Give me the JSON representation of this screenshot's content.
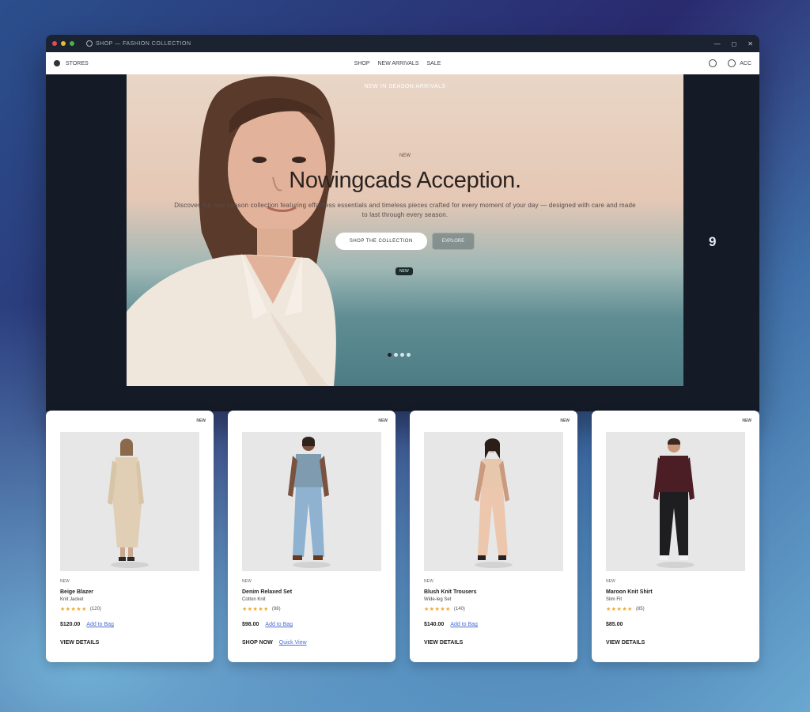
{
  "window": {
    "title": "SHOP — FASHION COLLECTION",
    "controls": [
      "—",
      "◻",
      "✕"
    ]
  },
  "navbar": {
    "brand": "STORES",
    "links": [
      "SHOP",
      "NEW ARRIVALS",
      "SALE"
    ],
    "user_label": "ACC"
  },
  "hero": {
    "top_label": "NEW IN SEASON ARRIVALS",
    "kicker": "NEW",
    "title": "Nowingcads Acception.",
    "subtitle": "Discover the new season collection featuring effortless essentials and timeless pieces crafted for every moment of your day — designed with care and made to last through every season.",
    "primary_button": "SHOP THE COLLECTION",
    "secondary_button": "EXPLORE",
    "tag": "NEW",
    "next_arrow": "9",
    "slide_count": 4,
    "active_slide": 0
  },
  "colors": {
    "accent_link": "#4a6fd4",
    "star": "#f1a62c",
    "card_bg": "#ffffff"
  },
  "products": [
    {
      "badge": "NEW",
      "category": "NEW",
      "name": "Beige Blazer",
      "desc": "Knit Jacket",
      "stars": "★★★★★",
      "reviews": "(120)",
      "price": "$120.00",
      "price_link": "Add to Bag",
      "cta": "VIEW DETAILS",
      "cta_link": ""
    },
    {
      "badge": "NEW",
      "category": "NEW",
      "name": "Denim Relaxed Set",
      "desc": "Cotton Knit",
      "stars": "★★★★★",
      "reviews": "(98)",
      "price": "$98.00",
      "price_link": "Add to Bag",
      "cta": "SHOP NOW",
      "cta_link": "Quick View"
    },
    {
      "badge": "NEW",
      "category": "NEW",
      "name": "Blush Knit Trousers",
      "desc": "Wide-leg Set",
      "stars": "★★★★★",
      "reviews": "(140)",
      "price": "$140.00",
      "price_link": "Add to Bag",
      "cta": "VIEW DETAILS",
      "cta_link": ""
    },
    {
      "badge": "NEW",
      "category": "NEW",
      "name": "Maroon Knit Shirt",
      "desc": "Slim Fit",
      "stars": "★★★★★",
      "reviews": "(85)",
      "price": "$85.00",
      "price_link": "",
      "cta": "VIEW DETAILS",
      "cta_link": ""
    }
  ]
}
